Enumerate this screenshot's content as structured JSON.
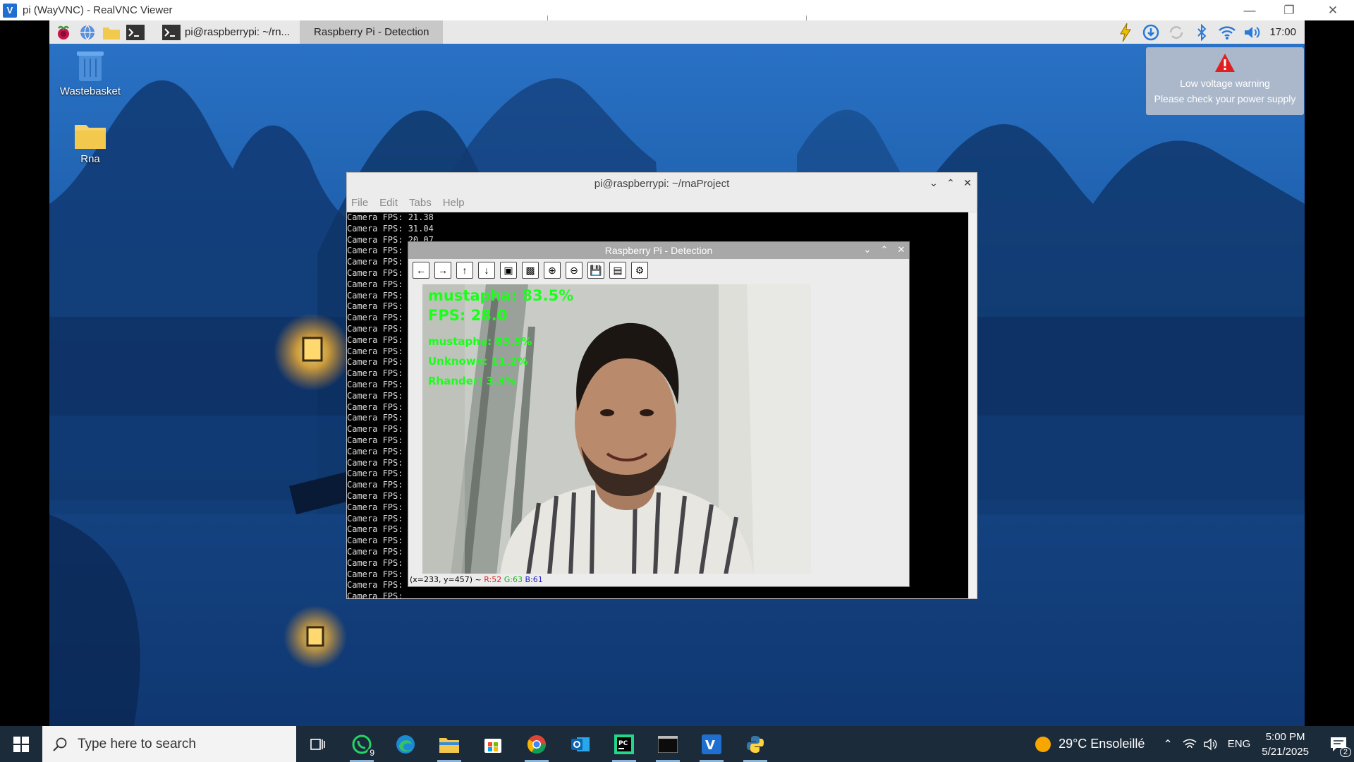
{
  "vnc": {
    "title": "pi (WayVNC) - RealVNC Viewer",
    "logo_icon": "realvnc-logo-icon"
  },
  "pi_panel": {
    "tasks": [
      {
        "label": "pi@raspberrypi: ~/rn...",
        "icon": "terminal-icon"
      },
      {
        "label": "Raspberry Pi - Detection",
        "icon": ""
      }
    ],
    "clock": "17:00"
  },
  "desktop": {
    "icons": [
      {
        "label": "Wastebasket",
        "icon": "trash-icon"
      },
      {
        "label": "Rna",
        "icon": "folder-icon"
      }
    ]
  },
  "notification": {
    "line1": "Low voltage warning",
    "line2": "Please check your power supply"
  },
  "terminal": {
    "title": "pi@raspberrypi: ~/rnaProject",
    "menu": [
      "File",
      "Edit",
      "Tabs",
      "Help"
    ],
    "first_lines": [
      "Camera FPS: 21.38",
      "Camera FPS: 31.04",
      "Camera FPS: 20.07"
    ],
    "repeat_line": "Camera FPS:"
  },
  "detection": {
    "title": "Raspberry Pi - Detection",
    "overlay": {
      "main_label": "mustapha: 83.5%",
      "fps": "FPS: 28.0",
      "scores": [
        "mustapha: 83.5%",
        "Unknown: 11.2%",
        "Rhander: 3.3%"
      ]
    },
    "status": {
      "coords": "(x=233, y=457) ~",
      "r": "R:52",
      "g": "G:63",
      "b": "B:61"
    }
  },
  "windows": {
    "search_placeholder": "Type here to search",
    "weather": "29°C  Ensoleillé",
    "lang": "ENG",
    "time": "5:00 PM",
    "date": "5/21/2025",
    "whatsapp_badge": "9",
    "notif_badge": "2"
  },
  "colors": {
    "overlay_green": "#1aff1a",
    "accent_blue": "#1f6fd0"
  }
}
